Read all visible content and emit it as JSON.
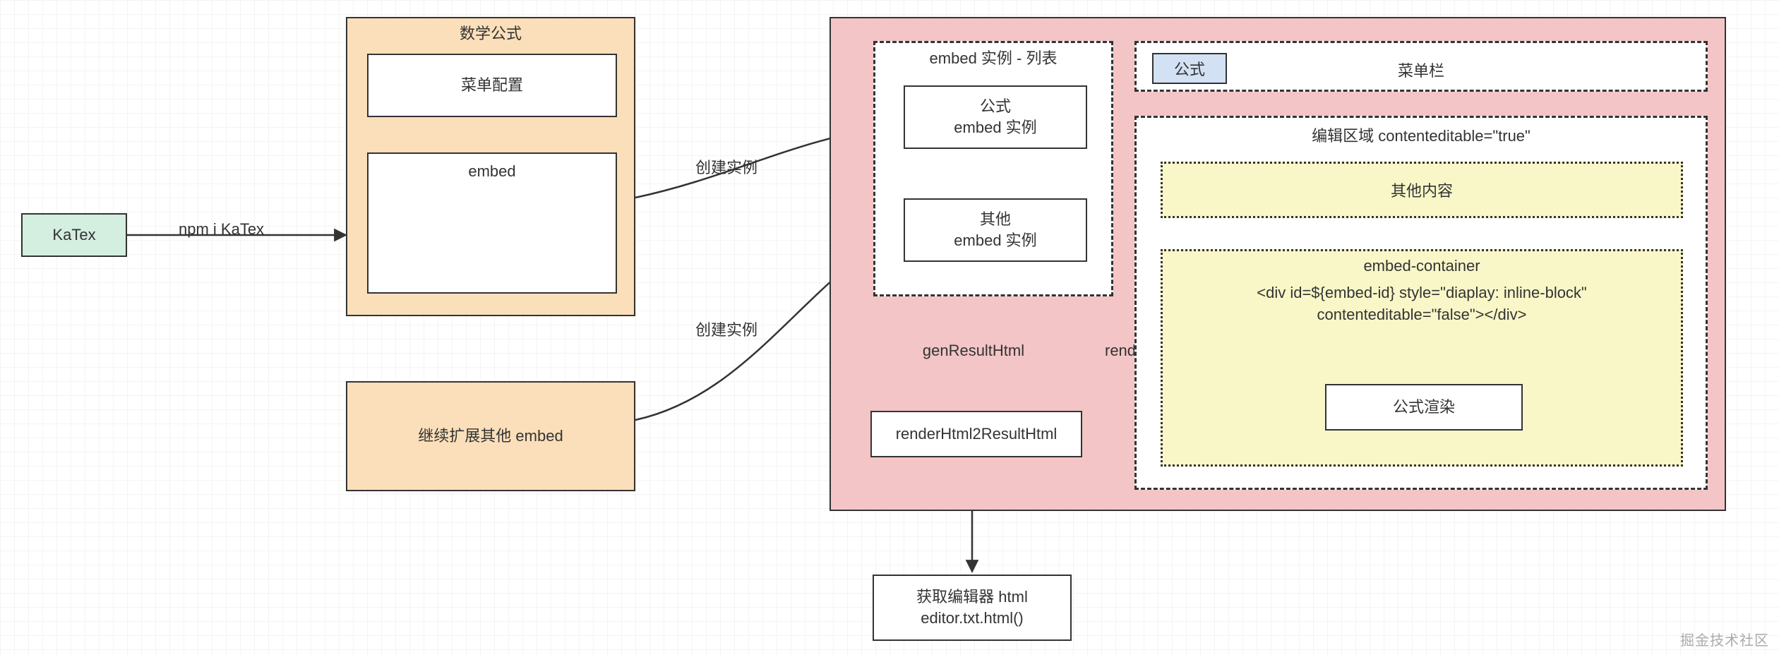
{
  "katex_node": "KaTex",
  "npm_edge": "npm i KaTex",
  "math_container": {
    "title": "数学公式",
    "menu_config": "菜单配置",
    "embed": "embed"
  },
  "extend_box": "继续扩展其他 embed",
  "create_instance_1": "创建实例",
  "create_instance_2": "创建实例",
  "pink_container": {
    "embed_list_title": "embed 实例 - 列表",
    "formula_instance": "公式\nembed 实例",
    "other_instance": "其他\nembed 实例",
    "genResultHtml": "genResultHtml",
    "renderHtml2ResultHtml": "renderHtml2ResultHtml",
    "renderHtml": "renderHtml",
    "chip_formula": "公式",
    "menubar": "菜单栏",
    "editor_area_title": "编辑区域 contenteditable=\"true\"",
    "other_content": "其他内容",
    "embed_container_title": "embed-container",
    "embed_container_code": "<div id=${embed-id} style=\"diaplay: inline-block\"\ncontenteditable=\"false\"></div>",
    "formula_render": "公式渲染"
  },
  "output_box": "获取编辑器 html\neditor.txt.html()",
  "watermark": "掘金技术社区"
}
